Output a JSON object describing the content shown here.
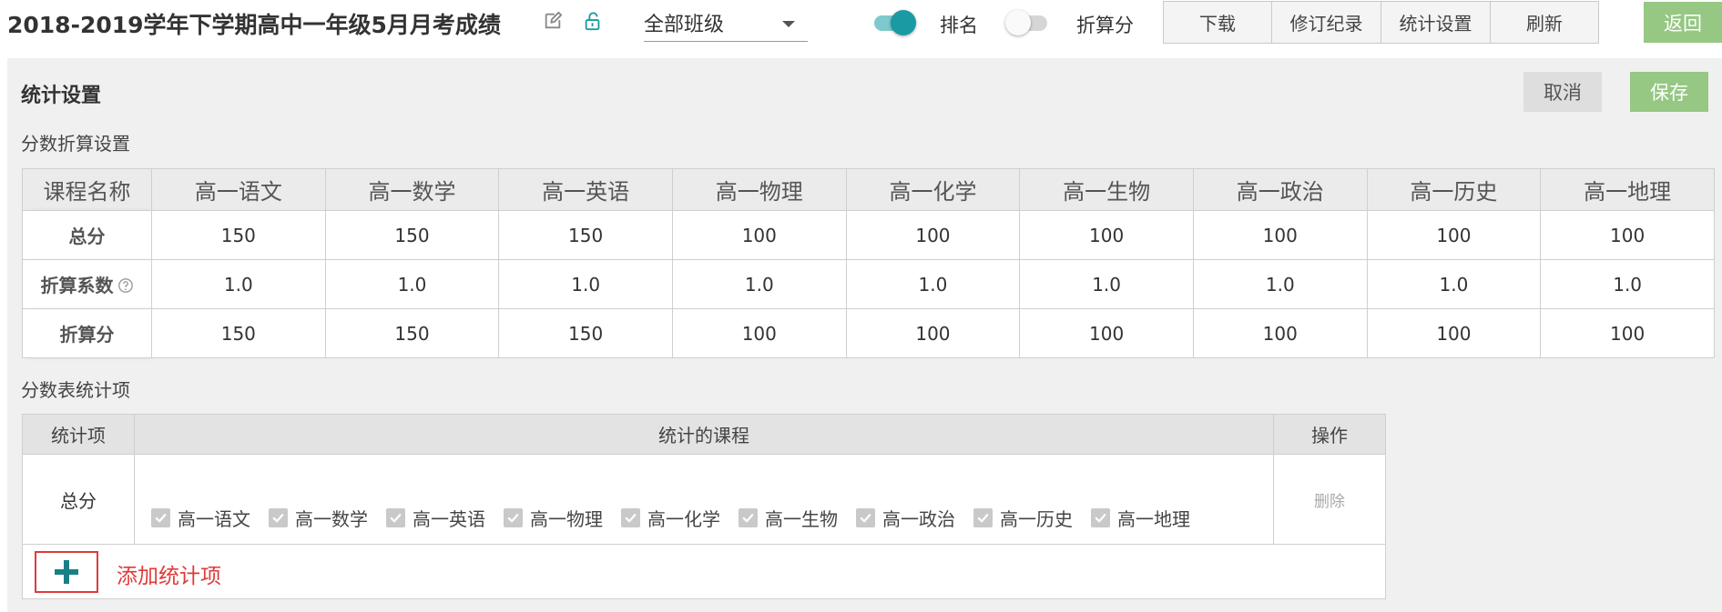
{
  "header": {
    "title": "2018-2019学年下学期高中一年级5月月考成绩",
    "class_select": {
      "value": "全部班级"
    },
    "toggles": [
      {
        "label": "排名",
        "on": true
      },
      {
        "label": "折算分",
        "on": false
      }
    ],
    "buttons": [
      "下载",
      "修订纪录",
      "统计设置",
      "刷新"
    ],
    "back_label": "返回"
  },
  "panel": {
    "title": "统计设置",
    "cancel_label": "取消",
    "save_label": "保存",
    "section1_label": "分数折算设置",
    "section2_label": "分数表统计项"
  },
  "score_table": {
    "columns": [
      "课程名称",
      "高一语文",
      "高一数学",
      "高一英语",
      "高一物理",
      "高一化学",
      "高一生物",
      "高一政治",
      "高一历史",
      "高一地理"
    ],
    "rows": [
      {
        "label": "总分",
        "values": [
          "150",
          "150",
          "150",
          "100",
          "100",
          "100",
          "100",
          "100",
          "100"
        ]
      },
      {
        "label": "折算系数",
        "values": [
          "1.0",
          "1.0",
          "1.0",
          "1.0",
          "1.0",
          "1.0",
          "1.0",
          "1.0",
          "1.0"
        ]
      },
      {
        "label": "折算分",
        "values": [
          "150",
          "150",
          "150",
          "100",
          "100",
          "100",
          "100",
          "100",
          "100"
        ]
      }
    ]
  },
  "stats_table": {
    "headers": [
      "统计项",
      "统计的课程",
      "操作"
    ],
    "rows": [
      {
        "name": "总分",
        "courses": [
          "高一语文",
          "高一数学",
          "高一英语",
          "高一物理",
          "高一化学",
          "高一生物",
          "高一政治",
          "高一历史",
          "高一地理"
        ],
        "action": "删除"
      }
    ]
  },
  "add_label": "添加统计项",
  "colors": {
    "accent_teal": "#1a9aa3",
    "green_button": "#96c783",
    "add_red": "#e03a3a"
  }
}
